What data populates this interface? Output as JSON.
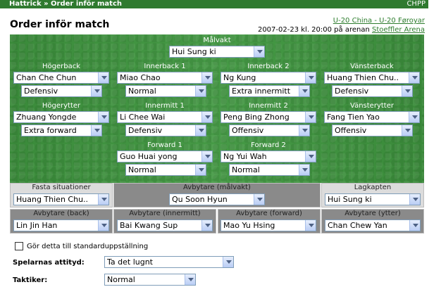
{
  "topbar": {
    "breadcrumb": "Hattrick » Order inför match",
    "chpp": "CHPP"
  },
  "page": {
    "title": "Order inför match"
  },
  "match": {
    "link": "U-20 China - U-20 Føroyar",
    "datetime_prefix": "2007-02-23 kl. 20:00 på arenan",
    "arena": "Stoeffler Arena"
  },
  "pitch": {
    "goalkeeper": {
      "label": "Målvakt",
      "player": "Hui Sung ki"
    },
    "right_back": {
      "label": "Högerback",
      "player": "Chan Che Chun",
      "order": "Defensiv"
    },
    "cb1": {
      "label": "Innerback 1",
      "player": "Miao Chao",
      "order": "Normal"
    },
    "cb2": {
      "label": "Innerback 2",
      "player": "Ng Kung",
      "order": "Extra innermitt"
    },
    "left_back": {
      "label": "Vänsterback",
      "player": "Huang Thien Chu..",
      "order": "Defensiv"
    },
    "right_winger": {
      "label": "Högerytter",
      "player": "Zhuang Yongde",
      "order": "Extra forward"
    },
    "im1": {
      "label": "Innermitt 1",
      "player": "Li Chee Wai",
      "order": "Defensiv"
    },
    "im2": {
      "label": "Innermitt 2",
      "player": "Peng Bing Zhong",
      "order": "Offensiv"
    },
    "left_winger": {
      "label": "Vänsterytter",
      "player": "Fang Tien Yao",
      "order": "Offensiv"
    },
    "fw1": {
      "label": "Forward 1",
      "player": "Guo Huai yong",
      "order": "Normal"
    },
    "fw2": {
      "label": "Forward 2",
      "player": "Ng Yui Wah",
      "order": "Normal"
    }
  },
  "extras": {
    "set_pieces": {
      "label": "Fasta situationer",
      "player": "Huang Thien Chu.."
    },
    "sub_gk": {
      "label": "Avbytare (målvakt)",
      "player": "Qu Soon Hyun"
    },
    "captain": {
      "label": "Lagkapten",
      "player": "Hui Sung ki"
    },
    "sub_back": {
      "label": "Avbytare (back)",
      "player": "Lin Jin Han"
    },
    "sub_im": {
      "label": "Avbytare (innermitt)",
      "player": "Bai Kwang Sup"
    },
    "sub_fw": {
      "label": "Avbytare (forward)",
      "player": "Mao Yu Hsing"
    },
    "sub_winger": {
      "label": "Avbytare (ytter)",
      "player": "Chan Chew Yan"
    }
  },
  "form": {
    "default_checkbox_label": "Gör detta till standarduppställning",
    "attitude_label": "Spelarnas attityd:",
    "attitude_value": "Ta det lugnt",
    "tactic_label": "Taktiker:",
    "tactic_value": "Normal"
  }
}
